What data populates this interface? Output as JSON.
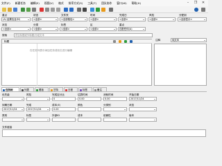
{
  "menu": [
    "文件(F)",
    "新建任务",
    "编辑(E)",
    "视图(V)",
    "格式",
    "排序方式(S)",
    "工具(T)",
    "团队协作",
    "窗口(W)",
    "帮助(H)"
  ],
  "filters": {
    "row1": {
      "labels": [
        "重点",
        "状态",
        "文件夹",
        "时间",
        "完成日",
        "风险",
        "分配到"
      ],
      "values": [
        "(A)  结果包含(M)",
        "<全部>",
        "<全部路径>",
        "<全部>",
        "<全部>",
        "<全部>",
        "<全部显示>"
      ]
    },
    "row2": {
      "labels": [
        "状态",
        "分类",
        "标签",
        "区",
        "重点"
      ],
      "values": [
        "<全部>",
        "<全部>",
        "<全部>",
        "<全部>",
        "匹配任何(A)"
      ]
    }
  },
  "search": {
    "label": "搜索",
    "placeholder": "项目标题或列标题/分组文本"
  },
  "list": {
    "title_header": "标题",
    "hint": "在任务列表中添加任务或双击进行编辑"
  },
  "right": {
    "label": "注释",
    "value": "纯文本"
  },
  "tabs": [
    "任务树",
    "列表",
    "看板",
    "甘特",
    "日程",
    "标签",
    "备注"
  ],
  "detail": {
    "row1": [
      "优先级",
      "风险",
      "完成百分比",
      "估算时间",
      "消耗时间",
      "开始日期"
    ],
    "row1v": [
      "",
      "",
      "0",
      "0.00",
      "0.00",
      "2017/11/24"
    ],
    "row2": [
      "到期日期",
      "完成",
      "成本(E)",
      "颜色",
      "分类别",
      "状态"
    ],
    "row2v": [
      "2017/11/24",
      "2017/11/24",
      "0.00",
      "",
      "",
      ""
    ],
    "row3": [
      "类别",
      "标签",
      "外部ID",
      "成本",
      "依赖性",
      "版本"
    ],
    "row3v": [
      "",
      "",
      "",
      "",
      "",
      ""
    ],
    "files": "文件链接"
  },
  "colors": {
    "accent": "#1f5fae",
    "green": "#2e9b3a",
    "red": "#d33",
    "orange": "#e89a1c"
  }
}
